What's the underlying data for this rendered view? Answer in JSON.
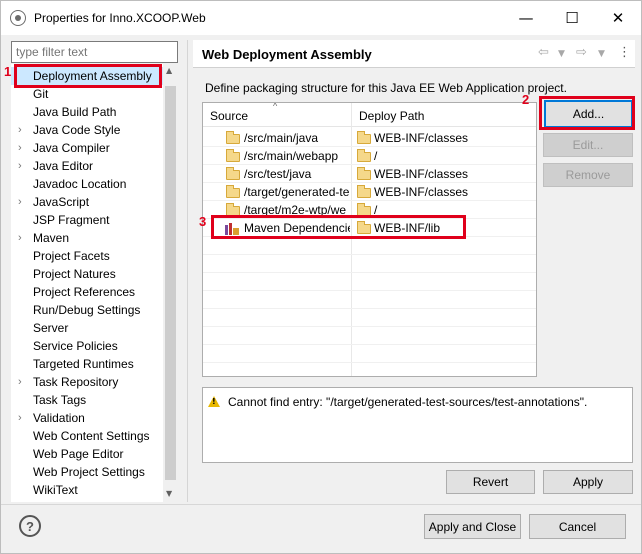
{
  "window": {
    "title": "Properties for Inno.XCOOP.Web",
    "minimize": "—",
    "maximize": "☐",
    "close": "✕"
  },
  "filter": {
    "placeholder": "type filter text"
  },
  "tree": {
    "items": [
      {
        "label": "Deployment Assembly",
        "expandable": false,
        "selected": true
      },
      {
        "label": "Git",
        "expandable": false
      },
      {
        "label": "Java Build Path",
        "expandable": false
      },
      {
        "label": "Java Code Style",
        "expandable": true
      },
      {
        "label": "Java Compiler",
        "expandable": true
      },
      {
        "label": "Java Editor",
        "expandable": true
      },
      {
        "label": "Javadoc Location",
        "expandable": false
      },
      {
        "label": "JavaScript",
        "expandable": true
      },
      {
        "label": "JSP Fragment",
        "expandable": false
      },
      {
        "label": "Maven",
        "expandable": true
      },
      {
        "label": "Project Facets",
        "expandable": false
      },
      {
        "label": "Project Natures",
        "expandable": false
      },
      {
        "label": "Project References",
        "expandable": false
      },
      {
        "label": "Run/Debug Settings",
        "expandable": false
      },
      {
        "label": "Server",
        "expandable": false
      },
      {
        "label": "Service Policies",
        "expandable": false
      },
      {
        "label": "Targeted Runtimes",
        "expandable": false
      },
      {
        "label": "Task Repository",
        "expandable": true
      },
      {
        "label": "Task Tags",
        "expandable": false
      },
      {
        "label": "Validation",
        "expandable": true
      },
      {
        "label": "Web Content Settings",
        "expandable": false
      },
      {
        "label": "Web Page Editor",
        "expandable": false
      },
      {
        "label": "Web Project Settings",
        "expandable": false
      },
      {
        "label": "WikiText",
        "expandable": false
      }
    ]
  },
  "page": {
    "title": "Web Deployment Assembly",
    "description": "Define packaging structure for this Java EE Web Application project."
  },
  "table": {
    "headers": {
      "source": "Source",
      "deploy_path": "Deploy Path"
    },
    "rows": [
      {
        "source": "/src/main/java",
        "deploy": "WEB-INF/classes",
        "icon": "folder-icon"
      },
      {
        "source": "/src/main/webapp",
        "deploy": "/",
        "icon": "folder-icon"
      },
      {
        "source": "/src/test/java",
        "deploy": "WEB-INF/classes",
        "icon": "folder-icon"
      },
      {
        "source": "/target/generated-te",
        "deploy": "WEB-INF/classes",
        "icon": "folder-icon"
      },
      {
        "source": "/target/m2e-wtp/we",
        "deploy": "/",
        "icon": "folder-icon"
      },
      {
        "source": "Maven Dependencie",
        "deploy": "WEB-INF/lib",
        "icon": "maven-library-icon"
      }
    ]
  },
  "buttons": {
    "add": "Add...",
    "edit": "Edit...",
    "remove": "Remove",
    "revert": "Revert",
    "apply": "Apply",
    "apply_close": "Apply and Close",
    "cancel": "Cancel"
  },
  "message": "Cannot find entry: \"/target/generated-test-sources/test-annotations\".",
  "annotations": {
    "one": "1",
    "two": "2",
    "three": "3"
  },
  "colors": {
    "annotation": "#e0001b",
    "selection": "#cce8ff",
    "default_button": "#0078d7"
  }
}
